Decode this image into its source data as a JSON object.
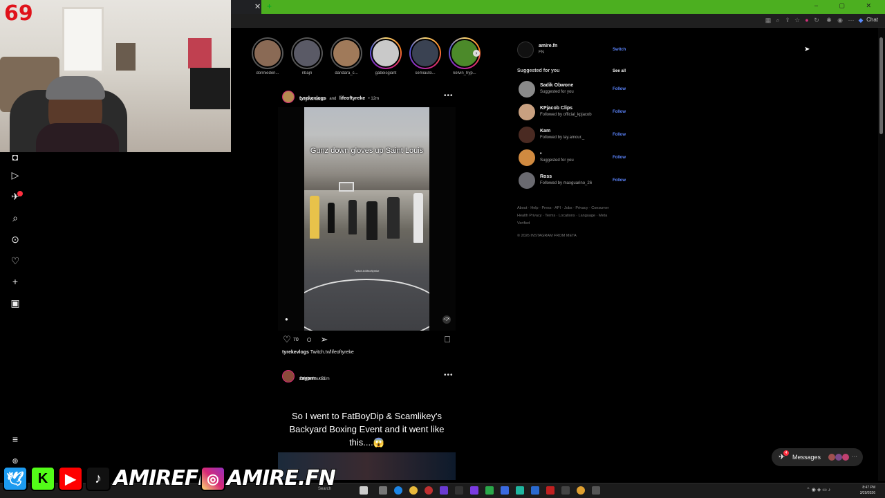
{
  "overlay": {
    "score": "69"
  },
  "stories": [
    {
      "username": "donnieden...",
      "color": "#8a6a55",
      "active": false
    },
    {
      "username": "nbajn",
      "color": "#5a5a66",
      "active": false
    },
    {
      "username": "dandara_c...",
      "color": "#a07a5a",
      "active": false
    },
    {
      "username": "gabeisgiant",
      "color": "#c9c9c9",
      "active": true
    },
    {
      "username": "semiauto...",
      "color": "#3a4252",
      "active": true
    },
    {
      "username": "kelvin_hyp...",
      "color": "#4c8a2a",
      "active": true
    }
  ],
  "post1": {
    "author": "tyrekevlogs",
    "and": "and",
    "coauthor": "lifeoftyreke",
    "time": "• 12m",
    "audio": "Original audio",
    "overlay_text": "Gunz down gloves up Saint Louis",
    "watermark": "Twitch.tv/lifeoftyreke",
    "likes": "70",
    "caption_user": "tyrekevlogs",
    "caption_text": "Twitch.tv/lifeoftyreke"
  },
  "post2": {
    "author": "zayprrr",
    "time": "• 21m",
    "audio": "Original audio",
    "overlay_text": "So I went to FatBoyDip & Scamlikey's Backyard Boxing Event and it went like this....😱"
  },
  "right": {
    "account_name": "amire.fn",
    "account_sub": "FN",
    "switch": "Switch",
    "suggested_title": "Suggested for you",
    "see_all": "See all",
    "suggestions": [
      {
        "name": "Sadik Obwone",
        "sub": "Suggested for you",
        "follow": "Follow",
        "color": "#8a8a8a"
      },
      {
        "name": "KPjacob Clips",
        "sub": "Followed by official_kpjacob",
        "follow": "Follow",
        "color": "#c8a080"
      },
      {
        "name": "Kam",
        "sub": "Followed by lay.amour._",
        "follow": "Follow",
        "color": "#4a2a22"
      },
      {
        "name": "•",
        "sub": "Suggested for you",
        "follow": "Follow",
        "color": "#d08a40"
      },
      {
        "name": "Ross",
        "sub": "Followed by maxguarino_26",
        "follow": "Follow",
        "color": "#6a6a70"
      }
    ],
    "footer": "About · Help · Press · API · Jobs · Privacy · Consumer Health Privacy · Terms · Locations · Language · Meta Verified",
    "copyright": "© 2026 INSTAGRAM FROM META"
  },
  "messages": {
    "label": "Messages",
    "badge": "4"
  },
  "browser": {
    "chat_label": "Chat"
  },
  "taskbar": {
    "search": "Search",
    "time": "8:47 PM",
    "date": "3/29/2026"
  },
  "banner": {
    "handle_1": "AMIREFN",
    "handle_2": "AMIRE.FN"
  }
}
